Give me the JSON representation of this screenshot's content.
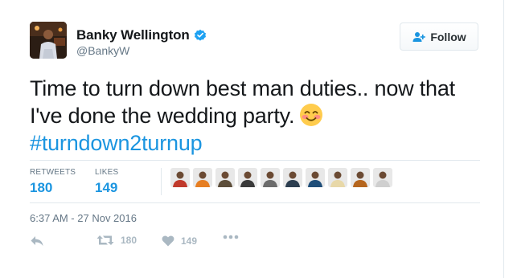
{
  "tweet": {
    "author": {
      "display_name": "Banky Wellington",
      "handle": "@BankyW",
      "verified": true,
      "avatar_icon": "profile-photo"
    },
    "follow_label": "Follow",
    "text_line1": "Time to turn down best man duties.. now that",
    "text_line2": "I've done the wedding party.",
    "emoji": "smiling-face-with-smiling-eyes",
    "hashtag": "#turndown2turnup",
    "stats": {
      "retweets_label": "RETWEETS",
      "retweets_value": "180",
      "likes_label": "LIKES",
      "likes_value": "149"
    },
    "likers": [
      {
        "icon": "liker-avatar-1",
        "color": "#c0392b"
      },
      {
        "icon": "liker-avatar-2",
        "color": "#e67e22"
      },
      {
        "icon": "liker-avatar-3",
        "color": "#5d4e3a"
      },
      {
        "icon": "liker-avatar-4",
        "color": "#3a3a3a"
      },
      {
        "icon": "liker-avatar-5",
        "color": "#6b6b6b"
      },
      {
        "icon": "liker-avatar-6",
        "color": "#2c3e50"
      },
      {
        "icon": "liker-avatar-7",
        "color": "#1f4e79"
      },
      {
        "icon": "liker-avatar-8",
        "color": "#e8d8a8"
      },
      {
        "icon": "liker-avatar-9",
        "color": "#b5651d"
      },
      {
        "icon": "liker-avatar-10",
        "color": "#cfcfcf"
      }
    ],
    "timestamp": "6:37 AM - 27 Nov 2016",
    "actions": {
      "reply_icon": "reply-icon",
      "retweet_count": "180",
      "like_count": "149",
      "more_icon": "more-icon"
    },
    "colors": {
      "link_blue": "#1b95e0",
      "muted_gray": "#657786",
      "action_gray": "#aab8c2",
      "border": "#e1e8ed"
    }
  }
}
